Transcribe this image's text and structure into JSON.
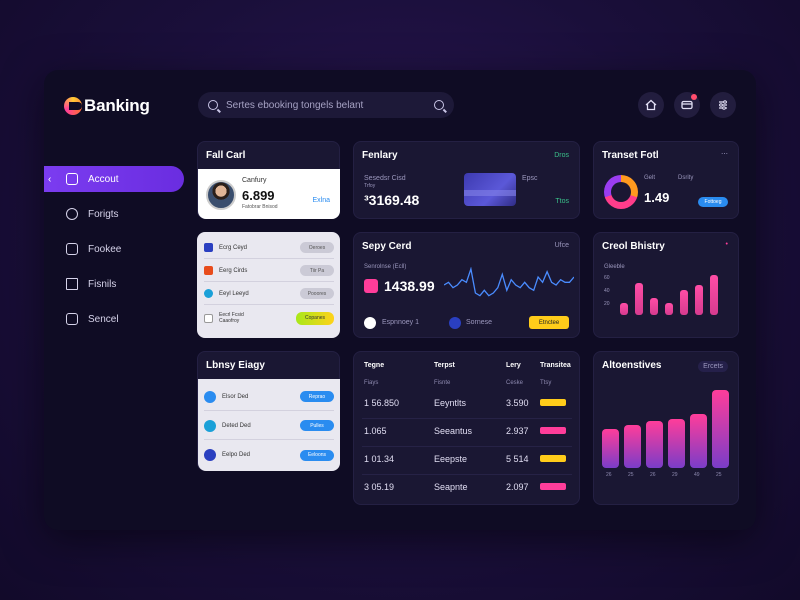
{
  "app": {
    "logo": "Banking"
  },
  "search": {
    "placeholder": "Sertes ebooking tongels belant"
  },
  "nav": [
    {
      "label": "Accout",
      "active": true
    },
    {
      "label": "Forigts"
    },
    {
      "label": "Fookee"
    },
    {
      "label": "Fisnils"
    },
    {
      "label": "Sencel"
    }
  ],
  "full_card": {
    "title": "Fall Carl",
    "label": "Canfury",
    "amount": "6.899",
    "sub": "Fatobrar Bnisod",
    "link": "Exlna"
  },
  "accounts": [
    {
      "name": "Ecrg Ceyd",
      "action": "Oeroes",
      "color": "#2a3fc0"
    },
    {
      "name": "Eerg Cirds",
      "action": "Tiir Pa",
      "color": "#e84c1c"
    },
    {
      "name": "Eeyl Leeyd",
      "action": "Pooores",
      "color": "#1aa0d8"
    },
    {
      "name": "Eecrl Fcsid Caaofroy",
      "action": "Copanes",
      "color": "#ffffff"
    }
  ],
  "family": {
    "title": "Fenlary",
    "label": "Sesedsr Cisd",
    "sub": "Trfoy",
    "amount": "³3169.48",
    "badge": "Dros",
    "card_label": "Epsc",
    "card_value": "Ttos"
  },
  "transact": {
    "title": "Transet Fotl",
    "label": "Gelt",
    "legend": "Dsrity",
    "amount": "1.49",
    "button": "Fottoeg"
  },
  "sepy": {
    "title": "Sepy Cerd",
    "badge": "Ufce",
    "label": "Senrolnse (Ecll)",
    "amount": "1438.99",
    "chip1": "Espnnoey 1",
    "chip2": "Sornese",
    "button": "Etnctee",
    "line": [
      6,
      7,
      5,
      6,
      8,
      7,
      12,
      3,
      2,
      4,
      2,
      3,
      5,
      10,
      4,
      8,
      6,
      5,
      7,
      5,
      4,
      9,
      7,
      11,
      7,
      6,
      8,
      7,
      7,
      9
    ]
  },
  "credit": {
    "title": "Creol Bhistry",
    "label": "Gleeble",
    "y": [
      "60",
      "40",
      "20"
    ],
    "bars": [
      5,
      13,
      7,
      5,
      10,
      12,
      16
    ]
  },
  "lousy": {
    "title": "Lbnsy Eiagy",
    "rows": [
      {
        "name": "Elsor Ded",
        "action": "Reprao",
        "color": "#2a8cf0"
      },
      {
        "name": "Deted Ded",
        "action": "Pulles",
        "color": "#1aa0d8"
      },
      {
        "name": "Eelpo Ded",
        "action": "Eeloons",
        "color": "#2a3fc0"
      }
    ]
  },
  "table": {
    "headers": [
      "Tegne",
      "Terpst",
      "Lery",
      "Transitea"
    ],
    "subheaders": [
      "Fiays",
      "Fisnte",
      "Ceske",
      "Ttsy"
    ],
    "rows": [
      {
        "a": "1 56.850",
        "b": "Eeyntlts",
        "c": "3.590",
        "tag": "#ffcc1a"
      },
      {
        "a": "1.065",
        "b": "Seeantus",
        "c": "2.937",
        "tag": "#ff3d9a"
      },
      {
        "a": "1 01.34",
        "b": "Eeepste",
        "c": "5 514",
        "tag": "#ffcc1a"
      },
      {
        "a": "3 05.19",
        "b": "Seapnte",
        "c": "2.097",
        "tag": "#ff3d9a"
      }
    ]
  },
  "alternatives": {
    "title": "Altoenstives",
    "badge": "Ercets",
    "bars": [
      40,
      44,
      48,
      50,
      55,
      80
    ],
    "labels": [
      "26",
      "25",
      "26",
      "29",
      "49",
      "25"
    ]
  }
}
